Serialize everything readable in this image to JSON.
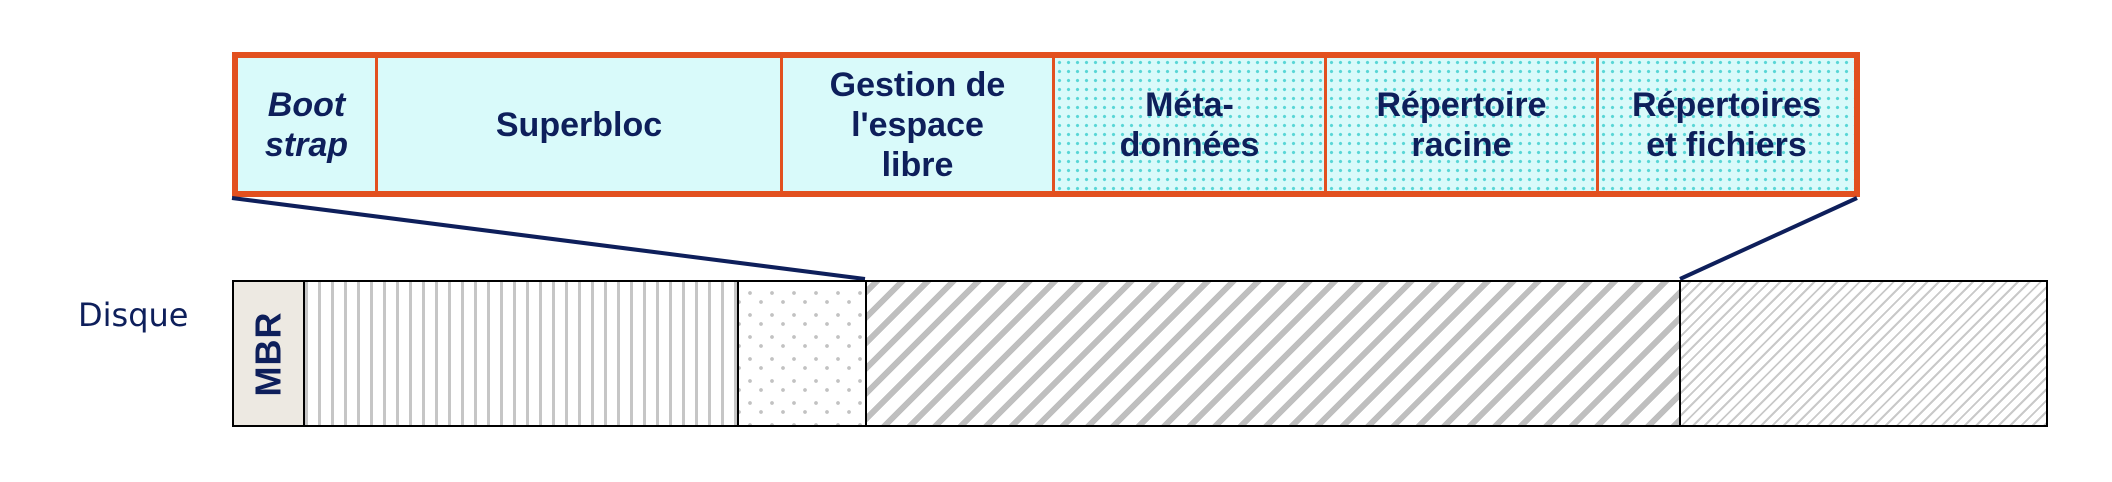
{
  "partition": {
    "segments": [
      {
        "label": "Boot\nstrap",
        "italic": true,
        "fill": "light-cyan"
      },
      {
        "label": "Superbloc",
        "italic": false,
        "fill": "light-cyan"
      },
      {
        "label": "Gestion de\nl'espace\nlibre",
        "italic": false,
        "fill": "light-cyan"
      },
      {
        "label": "Méta-\ndonnées",
        "italic": false,
        "fill": "dotted-cyan"
      },
      {
        "label": "Répertoire\nracine",
        "italic": false,
        "fill": "dotted-cyan"
      },
      {
        "label": "Répertoires\net fichiers",
        "italic": false,
        "fill": "dotted-cyan"
      }
    ]
  },
  "disk": {
    "label": "Disque",
    "mbr_label": "MBR",
    "patterns": [
      "mbr-solid",
      "vertical-lines",
      "confetti",
      "wide-diagonal",
      "fine-diagonal"
    ]
  },
  "colors": {
    "partition_border": "#e2501f",
    "partition_fill": "#d9fafa",
    "text": "#0e1f5b",
    "connector": "#0e1f5b",
    "mbr_fill": "#ede9e2"
  }
}
